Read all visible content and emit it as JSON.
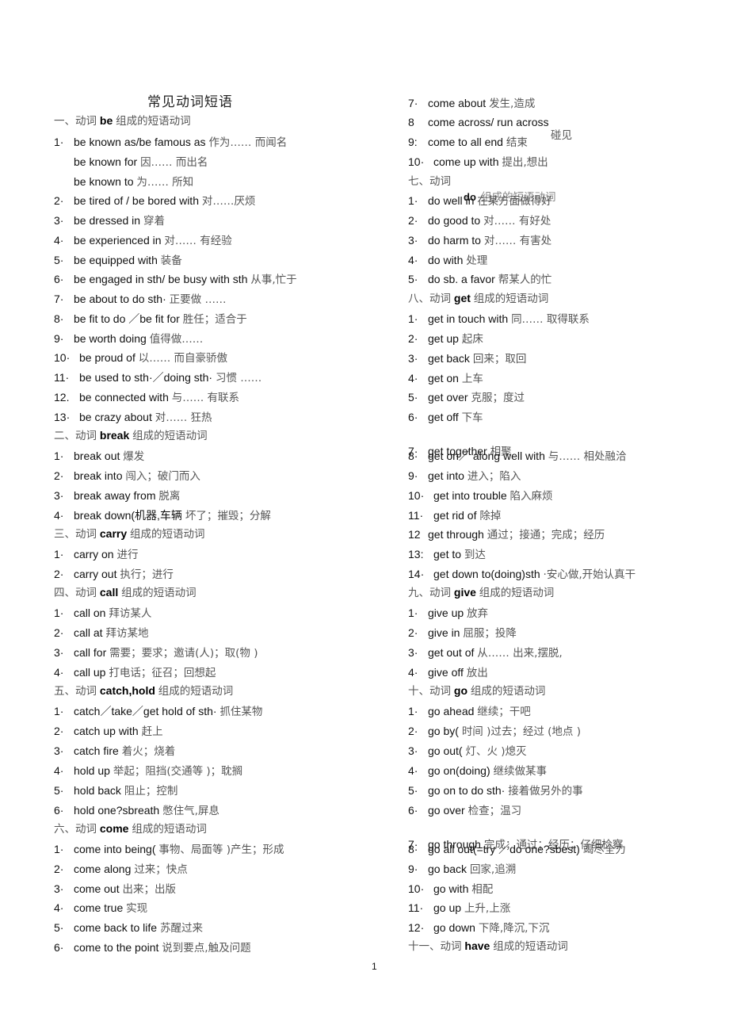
{
  "title": "常见动词短语",
  "page_number": "1",
  "left_column": [
    {
      "type": "head",
      "prefix": "一、动词",
      "verb": "be",
      "suffix": "组成的短语动词"
    },
    {
      "type": "item",
      "num": "1·",
      "en": "be known as/be famous as",
      "zh": "作为…… 而闻名"
    },
    {
      "type": "item",
      "num": "",
      "en": "be known for",
      "zh": "因…… 而出名"
    },
    {
      "type": "item",
      "num": "",
      "en": "be known to",
      "zh": "为…… 所知"
    },
    {
      "type": "item",
      "num": "2·",
      "en": "be tired of / be bored with",
      "zh": "对……厌烦"
    },
    {
      "type": "item",
      "num": "3·",
      "en": "be dressed in",
      "zh": "穿着"
    },
    {
      "type": "item",
      "num": "4·",
      "en": "be experienced in",
      "zh": "对…… 有经验"
    },
    {
      "type": "item",
      "num": "5·",
      "en": "be equipped with",
      "zh": "装备"
    },
    {
      "type": "item",
      "num": "6·",
      "en": "be engaged in sth/ be busy with sth",
      "zh": "从事,忙于"
    },
    {
      "type": "item",
      "num": "7·",
      "en": "be about to do sth·",
      "zh": "正要做 ……"
    },
    {
      "type": "item",
      "num": "8·",
      "en": "be fit to do ／be fit for",
      "zh": "胜任；适合于"
    },
    {
      "type": "item",
      "num": "9·",
      "en": "be worth doing",
      "zh": "值得做……"
    },
    {
      "type": "item",
      "num": "10·",
      "en": "be proud of",
      "zh": "以…… 而自豪骄傲"
    },
    {
      "type": "item",
      "num": "11·",
      "en": "be used to sth·／doing sth·",
      "zh": "习惯 ……"
    },
    {
      "type": "item",
      "num": "12.",
      "en": "be connected with",
      "zh": "与…… 有联系"
    },
    {
      "type": "item",
      "num": "13·",
      "en": "be crazy about",
      "zh": "对…… 狂热"
    },
    {
      "type": "head",
      "prefix": "二、动词",
      "verb": "break",
      "suffix": "组成的短语动词"
    },
    {
      "type": "item",
      "num": "1·",
      "en": "break out",
      "zh": "爆发"
    },
    {
      "type": "item",
      "num": "2·",
      "en": "break into",
      "zh": "闯入；破门而入"
    },
    {
      "type": "item",
      "num": "3·",
      "en": "break away from",
      "zh": "脱离"
    },
    {
      "type": "item",
      "num": "4·",
      "en": "break down(机器,车辆",
      "zh": "坏了；摧毁；分解"
    },
    {
      "type": "head",
      "prefix": "三、动词",
      "verb": "carry",
      "suffix": "组成的短语动词"
    },
    {
      "type": "item",
      "num": "1·",
      "en": "carry on",
      "zh": "进行"
    },
    {
      "type": "item",
      "num": "2·",
      "en": "carry out",
      "zh": "执行；进行"
    },
    {
      "type": "head",
      "prefix": "四、动词",
      "verb": "call",
      "suffix": "组成的短语动词"
    },
    {
      "type": "item",
      "num": "1·",
      "en": "call on",
      "zh": "拜访某人"
    },
    {
      "type": "item",
      "num": "2·",
      "en": "call at",
      "zh": "拜访某地"
    },
    {
      "type": "item",
      "num": "3·",
      "en": "call for",
      "zh": "需要；要求；邀请(人)；取(物 )"
    },
    {
      "type": "item",
      "num": "4·",
      "en": "call up",
      "zh": "打电话；征召；回想起"
    },
    {
      "type": "head",
      "prefix": "五、动词",
      "verb": "catch,hold",
      "suffix": "组成的短语动词"
    },
    {
      "type": "item",
      "num": "1·",
      "en": "catch／take／get hold of sth·",
      "zh": "抓住某物"
    },
    {
      "type": "item",
      "num": "2·",
      "en": "catch up with",
      "zh": "赶上"
    },
    {
      "type": "item",
      "num": "3·",
      "en": "catch fire",
      "zh": "着火；烧着"
    },
    {
      "type": "item",
      "num": "4·",
      "en": "hold up",
      "zh": "举起；阻挡(交通等 )；耽搁"
    },
    {
      "type": "item",
      "num": "5·",
      "en": "hold back",
      "zh": "阻止；控制"
    },
    {
      "type": "item",
      "num": "6·",
      "en": "hold one?sbreath",
      "zh": "憋住气,屏息"
    },
    {
      "type": "head",
      "prefix": "六、动词",
      "verb": "come",
      "suffix": "组成的短语动词"
    },
    {
      "type": "item",
      "num": "1·",
      "en": "come into being(",
      "zh": "事物、局面等 )产生；形成"
    },
    {
      "type": "item",
      "num": "2·",
      "en": "come along",
      "zh": "过来；快点"
    },
    {
      "type": "item",
      "num": "3·",
      "en": "come out",
      "zh": "出来；出版"
    },
    {
      "type": "item",
      "num": "4·",
      "en": "come true",
      "zh": "实现"
    },
    {
      "type": "item",
      "num": "5·",
      "en": "come back to life",
      "zh": "苏醒过来"
    },
    {
      "type": "item",
      "num": "6·",
      "en": "come to the point",
      "zh": "说到要点,触及问题"
    }
  ],
  "right_column": [
    {
      "type": "item",
      "num": "7·",
      "en": "come about",
      "zh": "发生,造成"
    },
    {
      "type": "item",
      "num": "8",
      "en": "come across/ run across",
      "zh": ""
    },
    {
      "type": "item",
      "num": "9:",
      "en": "come to all end",
      "zh": "结束",
      "extra": "碰见"
    },
    {
      "type": "item",
      "num": "10·",
      "en": "come up with",
      "zh": "提出,想出"
    },
    {
      "type": "head",
      "prefix": "七、动词",
      "verb": "",
      "suffix": ""
    },
    {
      "type": "item",
      "num": "1·",
      "en": "do well in",
      "zh": "在某方面做得好",
      "overlay_verb": "do",
      "overlay_zh": "组成的短语动词"
    },
    {
      "type": "item",
      "num": "2·",
      "en": "do good to",
      "zh": "对…… 有好处"
    },
    {
      "type": "item",
      "num": "3·",
      "en": "do harm to",
      "zh": "对…… 有害处"
    },
    {
      "type": "item",
      "num": "4·",
      "en": "do with",
      "zh": "处理"
    },
    {
      "type": "item",
      "num": "5·",
      "en": "do sb. a favor",
      "zh": "帮某人的忙"
    },
    {
      "type": "head",
      "prefix": "八、动词",
      "verb": "get",
      "suffix": "组成的短语动词"
    },
    {
      "type": "item",
      "num": "1·",
      "en": "get in touch with",
      "zh": "同…… 取得联系"
    },
    {
      "type": "item",
      "num": "2·",
      "en": "get up",
      "zh": "起床"
    },
    {
      "type": "item",
      "num": "3·",
      "en": "get back",
      "zh": "回来；取回"
    },
    {
      "type": "item",
      "num": "4·",
      "en": "get on",
      "zh": "上车"
    },
    {
      "type": "item",
      "num": "5·",
      "en": "get over",
      "zh": "克服；度过"
    },
    {
      "type": "item",
      "num": "6·",
      "en": "get off",
      "zh": "下车"
    },
    {
      "type": "item",
      "num": "7·",
      "en": "get together",
      "zh": "相聚"
    },
    {
      "type": "item",
      "num": "8·",
      "en": "get on／ along well with",
      "zh": "与…… 相处融洽"
    },
    {
      "type": "item",
      "num": "9·",
      "en": "get into",
      "zh": "进入；陷入"
    },
    {
      "type": "item",
      "num": "10·",
      "en": "get into trouble",
      "zh": "陷入麻烦"
    },
    {
      "type": "item",
      "num": "11·",
      "en": "get rid of",
      "zh": "除掉"
    },
    {
      "type": "item",
      "num": "12",
      "en": "get through",
      "zh": "通过；接通；完成；经历"
    },
    {
      "type": "item",
      "num": "13:",
      "en": "get to",
      "zh": "到达"
    },
    {
      "type": "item",
      "num": "14·",
      "en": "get down to(doing)sth",
      "zh": "·安心做,开始认真干"
    },
    {
      "type": "head",
      "prefix": "九、动词",
      "verb": "give",
      "suffix": "组成的短语动词"
    },
    {
      "type": "item",
      "num": "1·",
      "en": "give up",
      "zh": "放弃"
    },
    {
      "type": "item",
      "num": "2·",
      "en": "give in",
      "zh": "屈服；投降"
    },
    {
      "type": "item",
      "num": "3·",
      "en": "get out of",
      "zh": "从…… 出来,摆脱,"
    },
    {
      "type": "item",
      "num": "4·",
      "en": "give off",
      "zh": "放出"
    },
    {
      "type": "head",
      "prefix": "十、动词",
      "verb": "go",
      "suffix": "组成的短语动词"
    },
    {
      "type": "item",
      "num": "1·",
      "en": "go ahead",
      "zh": "继续；干吧"
    },
    {
      "type": "item",
      "num": "2·",
      "en": "go by(",
      "zh": "时间 )过去；经过 (地点 )"
    },
    {
      "type": "item",
      "num": "3·",
      "en": "go out(",
      "zh": "灯、火 )熄灭"
    },
    {
      "type": "item",
      "num": "4·",
      "en": "go on(doing)",
      "zh": "继续做某事"
    },
    {
      "type": "item",
      "num": "5·",
      "en": "go on to do sth·",
      "zh": "接着做另外的事"
    },
    {
      "type": "item",
      "num": "6·",
      "en": "go over",
      "zh": "检查；温习"
    },
    {
      "type": "item",
      "num": "7·",
      "en": "go through",
      "zh": "完成；通过；经历；仔细检察"
    },
    {
      "type": "item",
      "num": "8·",
      "en": "go all out(=try ／do one?sbest)",
      "zh": "竭尽全力"
    },
    {
      "type": "item",
      "num": "9·",
      "en": "go back",
      "zh": "回家,追溯"
    },
    {
      "type": "item",
      "num": "10·",
      "en": "go with",
      "zh": "相配"
    },
    {
      "type": "item",
      "num": "11·",
      "en": "go up",
      "zh": "上升,上涨"
    },
    {
      "type": "item",
      "num": "12·",
      "en": "go down",
      "zh": "下降,降沉,下沉"
    },
    {
      "type": "head",
      "prefix": "十一、动词",
      "verb": "have",
      "suffix": "组成的短语动词"
    }
  ]
}
